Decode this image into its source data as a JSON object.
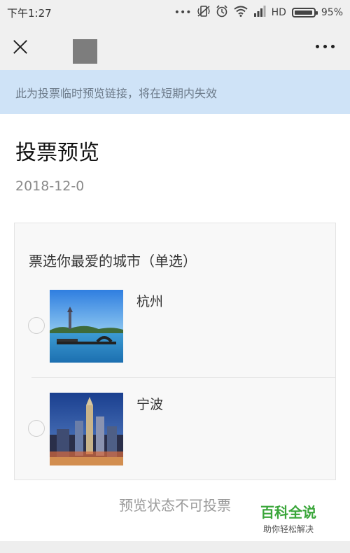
{
  "status_bar": {
    "time": "下午1:27",
    "network": "HD",
    "battery": "95%",
    "battery_level": 0.95,
    "icons": [
      "more-dots-icon",
      "vibrate-icon",
      "alarm-icon",
      "wifi-icon",
      "signal-icon",
      "battery-icon"
    ]
  },
  "nav": {
    "close_icon": "close-icon",
    "more_icon": "more-icon"
  },
  "notice": "此为投票临时预览链接，将在短期内失效",
  "page": {
    "title": "投票预览",
    "date": "2018-12-0"
  },
  "vote": {
    "question": "票选你最爱的城市（单选）",
    "options": [
      {
        "label": "杭州",
        "image": "hangzhou-lake-pagoda-photo"
      },
      {
        "label": "宁波",
        "image": "ningbo-night-skyline-photo"
      }
    ]
  },
  "footer": {
    "preview_note": "预览状态不可投票"
  },
  "watermark": {
    "title": "百科全说",
    "subtitle": "助你轻松解决"
  },
  "colors": {
    "notice_bg": "#cfe3f7",
    "notice_text": "#6c7a89",
    "watermark_green": "#3aa63a"
  }
}
